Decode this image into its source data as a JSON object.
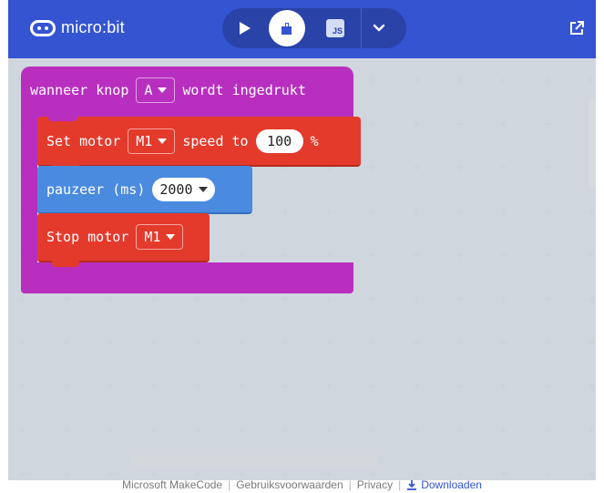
{
  "header": {
    "brand": "micro:bit",
    "js_label": "JS",
    "colors": {
      "bar": "#3454D1",
      "toggle": "#2A43A9"
    },
    "icons": [
      "microbit-logo-icon",
      "play-icon",
      "blocks-icon",
      "javascript-icon",
      "chevron-down-icon",
      "external-link-icon"
    ]
  },
  "workspace": {
    "event_block": {
      "prefix": "wanneer knop",
      "button_value": "A",
      "suffix": "wordt ingedrukt",
      "color": "#B82FC0"
    },
    "set_motor_block": {
      "label": "Set motor",
      "motor_value": "M1",
      "speed_label": "speed to",
      "speed_value": "100",
      "unit": "%",
      "color": "#E33A2C"
    },
    "pause_block": {
      "label": "pauzeer (ms)",
      "value": "2000",
      "color": "#4A8BE0"
    },
    "stop_motor_block": {
      "label": "Stop motor",
      "motor_value": "M1",
      "color": "#E33A2C"
    }
  },
  "footer": {
    "links": [
      "Microsoft MakeCode",
      "Gebruiksvoorwaarden",
      "Privacy"
    ],
    "download_label": "Downloaden"
  }
}
